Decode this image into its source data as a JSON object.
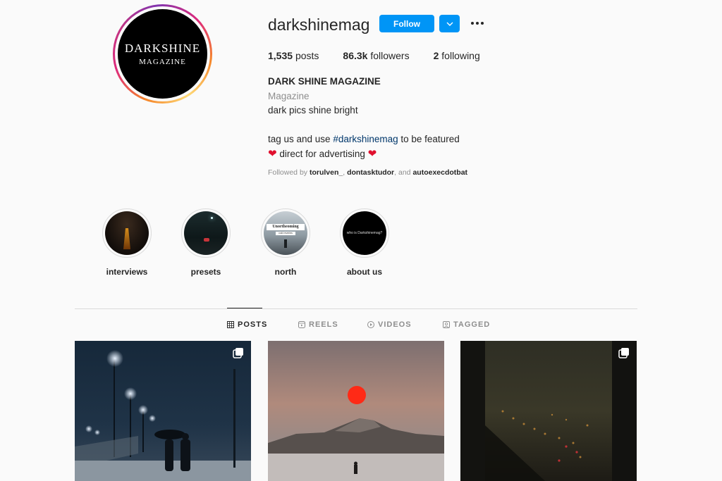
{
  "profile": {
    "username": "darkshinemag",
    "avatar_line1": "DARKSHINE",
    "avatar_line2": "MAGAZINE",
    "follow_label": "Follow",
    "stats": [
      {
        "num": "1,535",
        "label": "posts"
      },
      {
        "num": "86.3k",
        "label": "followers"
      },
      {
        "num": "2",
        "label": "following"
      }
    ],
    "bio": {
      "name": "DARK SHINE MAGAZINE",
      "category": "Magazine",
      "line1": "dark pics shine bright",
      "line2_pre": "tag us and use ",
      "hashtag": "#darkshinemag",
      "line2_post": " to be featured",
      "line3": " direct for advertising "
    },
    "followed_by": {
      "prefix": "Followed by ",
      "user1": "torulven_",
      "sep1": ", ",
      "user2": "dontasktudor",
      "sep2": ", and ",
      "user3": "autoexecdotbat"
    }
  },
  "highlights": [
    {
      "label": "interviews"
    },
    {
      "label": "presets"
    },
    {
      "label": "north",
      "overlay": "Unortheoming",
      "overlay_sub": "cold reveries"
    },
    {
      "label": "about us",
      "overlay": "who is Darkshinemag?"
    }
  ],
  "tabs": [
    {
      "label": "POSTS",
      "icon": "grid-icon",
      "active": true
    },
    {
      "label": "REELS",
      "icon": "reels-icon",
      "active": false
    },
    {
      "label": "VIDEOS",
      "icon": "play-icon",
      "active": false
    },
    {
      "label": "TAGGED",
      "icon": "tag-icon",
      "active": false
    }
  ],
  "colors": {
    "accent": "#0095f6",
    "text": "#262626",
    "muted": "#8e8e8e",
    "link": "#00376b",
    "heart": "#e0102e"
  }
}
